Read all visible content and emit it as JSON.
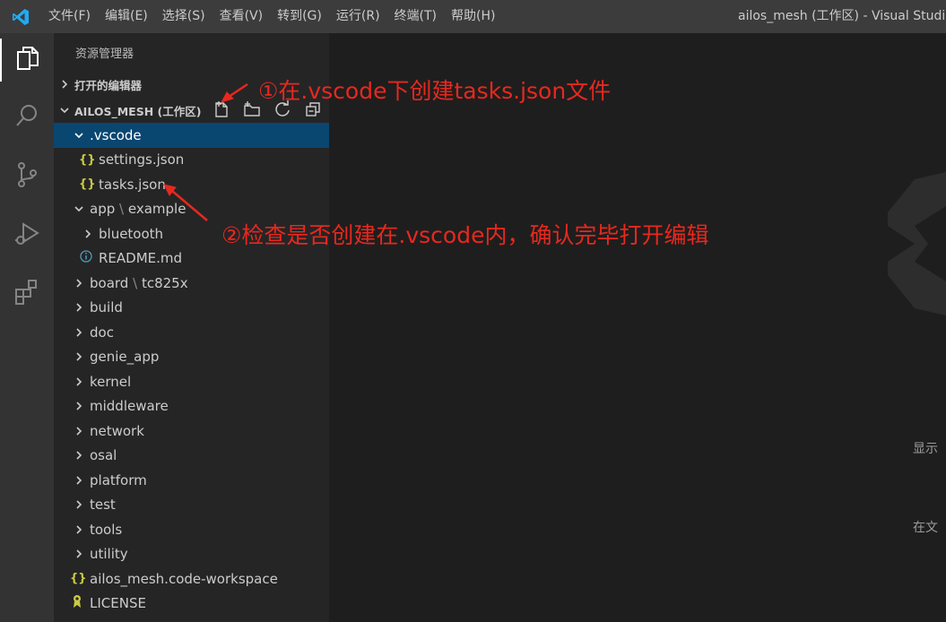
{
  "titlebar": {
    "menu": [
      "文件(F)",
      "编辑(E)",
      "选择(S)",
      "查看(V)",
      "转到(G)",
      "运行(R)",
      "终端(T)",
      "帮助(H)"
    ],
    "window_title": "ailos_mesh (工作区) - Visual Studio"
  },
  "activitybar": {
    "items": [
      {
        "icon": "files-icon",
        "active": true
      },
      {
        "icon": "search-icon",
        "active": false
      },
      {
        "icon": "source-control-icon",
        "active": false
      },
      {
        "icon": "run-debug-icon",
        "active": false
      },
      {
        "icon": "extensions-icon",
        "active": false
      }
    ]
  },
  "sidebar": {
    "title": "资源管理器",
    "open_editors": "打开的编辑器",
    "workspace": "AILOS_MESH (工作区)",
    "tree": [
      {
        "label": ".vscode",
        "type": "folder",
        "expanded": true,
        "depth": 0,
        "selected": true
      },
      {
        "label": "settings.json",
        "type": "json",
        "depth": 1
      },
      {
        "label": "tasks.json",
        "type": "json",
        "depth": 1
      },
      {
        "label_a": "app",
        "label_sep": "\\",
        "label_b": "example",
        "type": "folder",
        "expanded": true,
        "depth": 0
      },
      {
        "label": "bluetooth",
        "type": "folder",
        "expanded": false,
        "depth": 1
      },
      {
        "label": "README.md",
        "type": "info",
        "depth": 1
      },
      {
        "label_a": "board",
        "label_sep": "\\",
        "label_b": "tc825x",
        "type": "folder",
        "expanded": false,
        "depth": 0
      },
      {
        "label": "build",
        "type": "folder",
        "expanded": false,
        "depth": 0
      },
      {
        "label": "doc",
        "type": "folder",
        "expanded": false,
        "depth": 0
      },
      {
        "label": "genie_app",
        "type": "folder",
        "expanded": false,
        "depth": 0
      },
      {
        "label": "kernel",
        "type": "folder",
        "expanded": false,
        "depth": 0
      },
      {
        "label": "middleware",
        "type": "folder",
        "expanded": false,
        "depth": 0
      },
      {
        "label": "network",
        "type": "folder",
        "expanded": false,
        "depth": 0
      },
      {
        "label": "osal",
        "type": "folder",
        "expanded": false,
        "depth": 0
      },
      {
        "label": "platform",
        "type": "folder",
        "expanded": false,
        "depth": 0
      },
      {
        "label": "test",
        "type": "folder",
        "expanded": false,
        "depth": 0
      },
      {
        "label": "tools",
        "type": "folder",
        "expanded": false,
        "depth": 0
      },
      {
        "label": "utility",
        "type": "folder",
        "expanded": false,
        "depth": 0
      },
      {
        "label": "ailos_mesh.code-workspace",
        "type": "json",
        "depth": 0
      },
      {
        "label": "LICENSE",
        "type": "license",
        "depth": 0
      }
    ]
  },
  "editor": {
    "hint_1": "显示",
    "hint_2": "在文"
  },
  "annotations": {
    "step1": "①在.vscode下创建tasks.json文件",
    "step2": "②检查是否创建在.vscode内，确认完毕打开编辑"
  },
  "colors": {
    "annotation": "#e8281e",
    "selection": "#094771",
    "sidebar": "#252526",
    "activitybar": "#333333",
    "titlebar": "#3c3c3c",
    "json_icon": "#cbcb41",
    "vscode_blue": "#23a9f2"
  }
}
